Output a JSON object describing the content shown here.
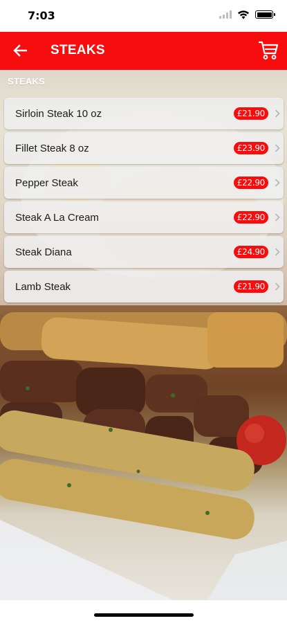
{
  "status_bar": {
    "time": "7:03",
    "icons": [
      "signal-icon",
      "wifi-icon",
      "battery-icon"
    ]
  },
  "app_bar": {
    "title": "STEAKS",
    "back_icon": "arrow-left-icon",
    "cart_icon": "cart-icon",
    "color": "#f70d0d"
  },
  "section": {
    "title": "STEAKS"
  },
  "menu_items": [
    {
      "name": "Sirloin Steak 10 oz",
      "price": "£21.90"
    },
    {
      "name": "Fillet Steak 8 oz",
      "price": "£23.90"
    },
    {
      "name": "Pepper Steak",
      "price": "£22.90"
    },
    {
      "name": "Steak A La Cream",
      "price": "£22.90"
    },
    {
      "name": "Steak Diana",
      "price": "£24.90"
    },
    {
      "name": "Lamb Steak",
      "price": "£21.90"
    }
  ],
  "colors": {
    "accent": "#f70d0d",
    "badge_text": "#ffffff"
  }
}
